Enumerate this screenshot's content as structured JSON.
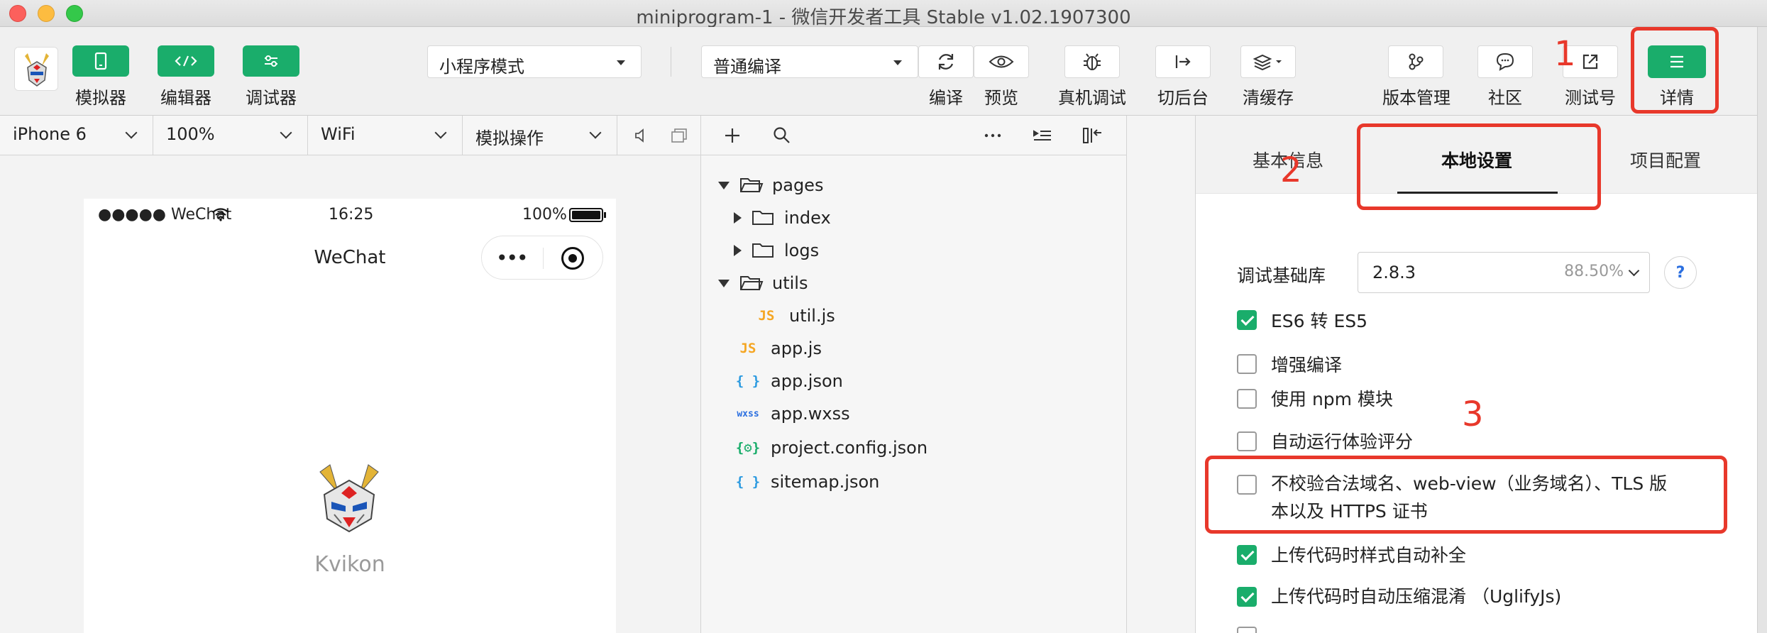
{
  "window": {
    "title": "miniprogram-1 - 微信开发者工具 Stable v1.02.1907300"
  },
  "toolbar": {
    "left_buttons": [
      {
        "label": "模拟器",
        "icon": "phone-icon"
      },
      {
        "label": "编辑器",
        "icon": "code-icon"
      },
      {
        "label": "调试器",
        "icon": "debug-sliders-icon"
      }
    ],
    "mode_select": "小程序模式",
    "compile_select": "普通编译",
    "actions": [
      {
        "label": "编译",
        "icon": "refresh-icon"
      },
      {
        "label": "预览",
        "icon": "eye-icon"
      },
      {
        "label": "真机调试",
        "icon": "bug-icon"
      },
      {
        "label": "切后台",
        "icon": "switch-background-icon"
      },
      {
        "label": "清缓存",
        "icon": "layers-icon"
      }
    ],
    "right_actions": [
      {
        "label": "版本管理",
        "icon": "branch-icon"
      },
      {
        "label": "社区",
        "icon": "chat-bubble-icon"
      },
      {
        "label": "测试号",
        "icon": "external-link-icon"
      },
      {
        "label": "详情",
        "icon": "menu-icon"
      }
    ]
  },
  "simulator": {
    "device": "iPhone 6",
    "zoom": "100%",
    "network": "WiFi",
    "operation": "模拟操作",
    "status_bar": {
      "carrier": "●●●●● WeChat",
      "time": "16:25",
      "battery": "100%"
    },
    "nav_title": "WeChat",
    "capsule_dots": "•••",
    "app_name": "Kvikon"
  },
  "file_tree": [
    {
      "name": "pages",
      "type": "folder",
      "expanded": true,
      "depth": 0
    },
    {
      "name": "index",
      "type": "folder",
      "expanded": false,
      "depth": 1
    },
    {
      "name": "logs",
      "type": "folder",
      "expanded": false,
      "depth": 1
    },
    {
      "name": "utils",
      "type": "folder",
      "expanded": true,
      "depth": 0
    },
    {
      "name": "util.js",
      "type": "js",
      "depth": 1
    },
    {
      "name": "app.js",
      "type": "js",
      "depth": 0
    },
    {
      "name": "app.json",
      "type": "json",
      "depth": 0
    },
    {
      "name": "app.wxss",
      "type": "wxss",
      "depth": 0
    },
    {
      "name": "project.config.json",
      "type": "config",
      "depth": 0
    },
    {
      "name": "sitemap.json",
      "type": "json",
      "depth": 0
    }
  ],
  "file_icons": {
    "js": "JS",
    "json": "{ }",
    "wxss": "wxss",
    "config": "{⚙}"
  },
  "details": {
    "tabs": [
      "基本信息",
      "本地设置",
      "项目配置"
    ],
    "active_tab": "本地设置",
    "base_lib_label": "调试基础库",
    "base_lib_version": "2.8.3",
    "base_lib_percent": "88.50%",
    "help": "?",
    "options": [
      {
        "label": "ES6 转 ES5",
        "checked": true
      },
      {
        "label": "增强编译",
        "checked": false
      },
      {
        "label": "使用 npm 模块",
        "checked": false
      },
      {
        "label": "自动运行体验评分",
        "checked": false
      },
      {
        "label": "不校验合法域名、web-view（业务域名）、TLS 版",
        "label2": "本以及 HTTPS 证书",
        "checked": false
      },
      {
        "label": "上传代码时样式自动补全",
        "checked": true
      },
      {
        "label": "上传代码时自动压缩混淆 （UglifyJs)",
        "checked": true
      }
    ]
  },
  "annotations": [
    "1",
    "2",
    "3"
  ],
  "colors": {
    "accent_green": "#1aad6b",
    "annotation_red": "#e8382b"
  }
}
